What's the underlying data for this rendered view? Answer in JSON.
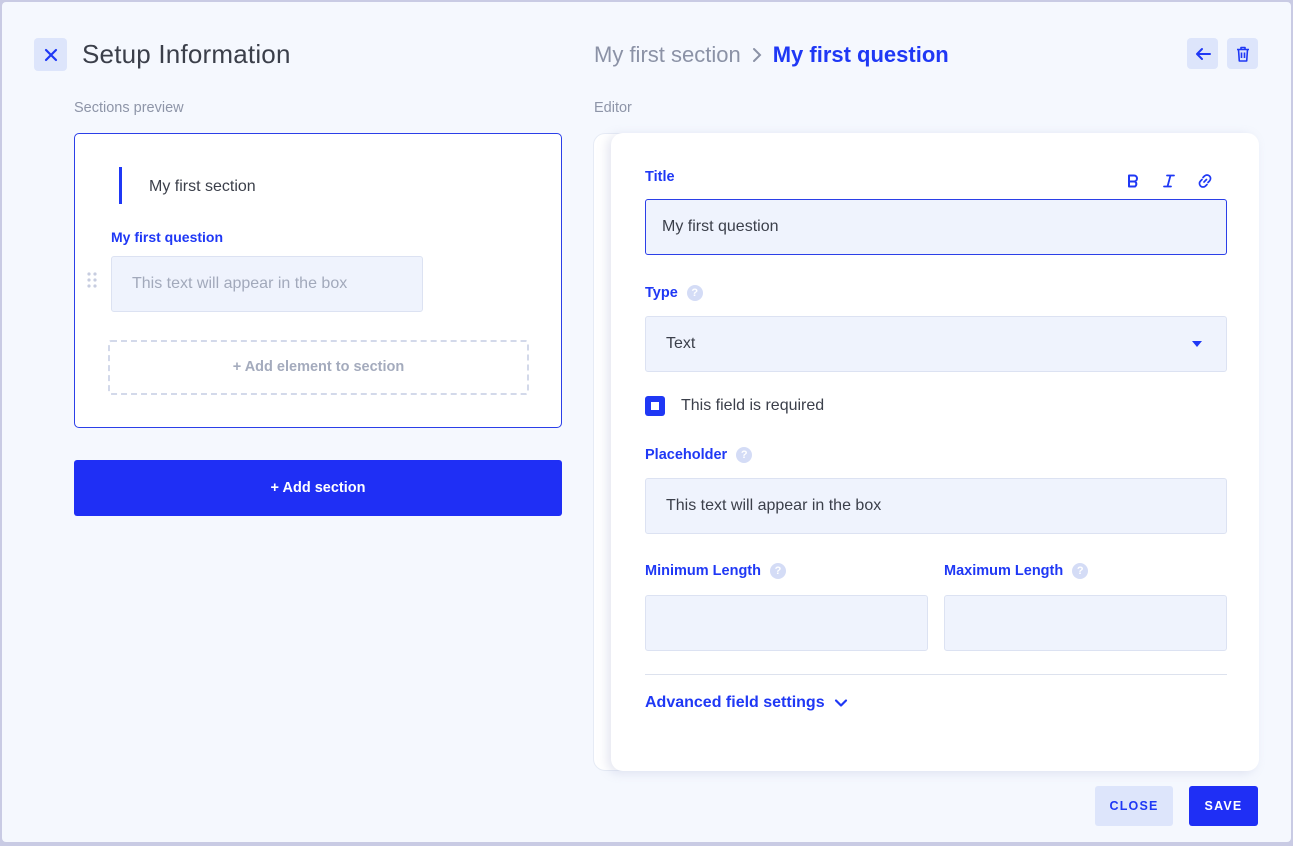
{
  "header": {
    "title": "Setup Information",
    "breadcrumb": {
      "section": "My first section",
      "question": "My first question"
    }
  },
  "icons": {
    "close": "close-icon",
    "chevron": "chevron-right-icon",
    "back": "arrow-left-icon",
    "delete": "trash-icon",
    "drag": "drag-handle-icon",
    "bold": "bold-icon",
    "italic": "italic-icon",
    "link": "link-icon",
    "help": "help-icon",
    "dropdown": "caret-down-icon",
    "expand": "chevron-down-icon"
  },
  "preview": {
    "label": "Sections preview",
    "section_name": "My first section",
    "question_label": "My first question",
    "question_placeholder": "This text will appear in the box",
    "add_element": "+ Add element to section",
    "add_section": "+ Add section"
  },
  "editor": {
    "label": "Editor",
    "title_label": "Title",
    "title_value": "My first question",
    "type_label": "Type",
    "type_value": "Text",
    "required_label": "This field is required",
    "required_checked": true,
    "placeholder_label": "Placeholder",
    "placeholder_value": "This text will appear in the box",
    "min_length_label": "Minimum Length",
    "min_length_value": "",
    "max_length_label": "Maximum Length",
    "max_length_value": "",
    "advanced_label": "Advanced field settings",
    "help_glyph": "?"
  },
  "footer": {
    "close_label": "CLOSE",
    "save_label": "SAVE"
  },
  "colors": {
    "accent": "#1f38f5",
    "background": "#f5f8fe",
    "input_bg": "#eff3fd",
    "soft_button": "#dde5fb"
  }
}
